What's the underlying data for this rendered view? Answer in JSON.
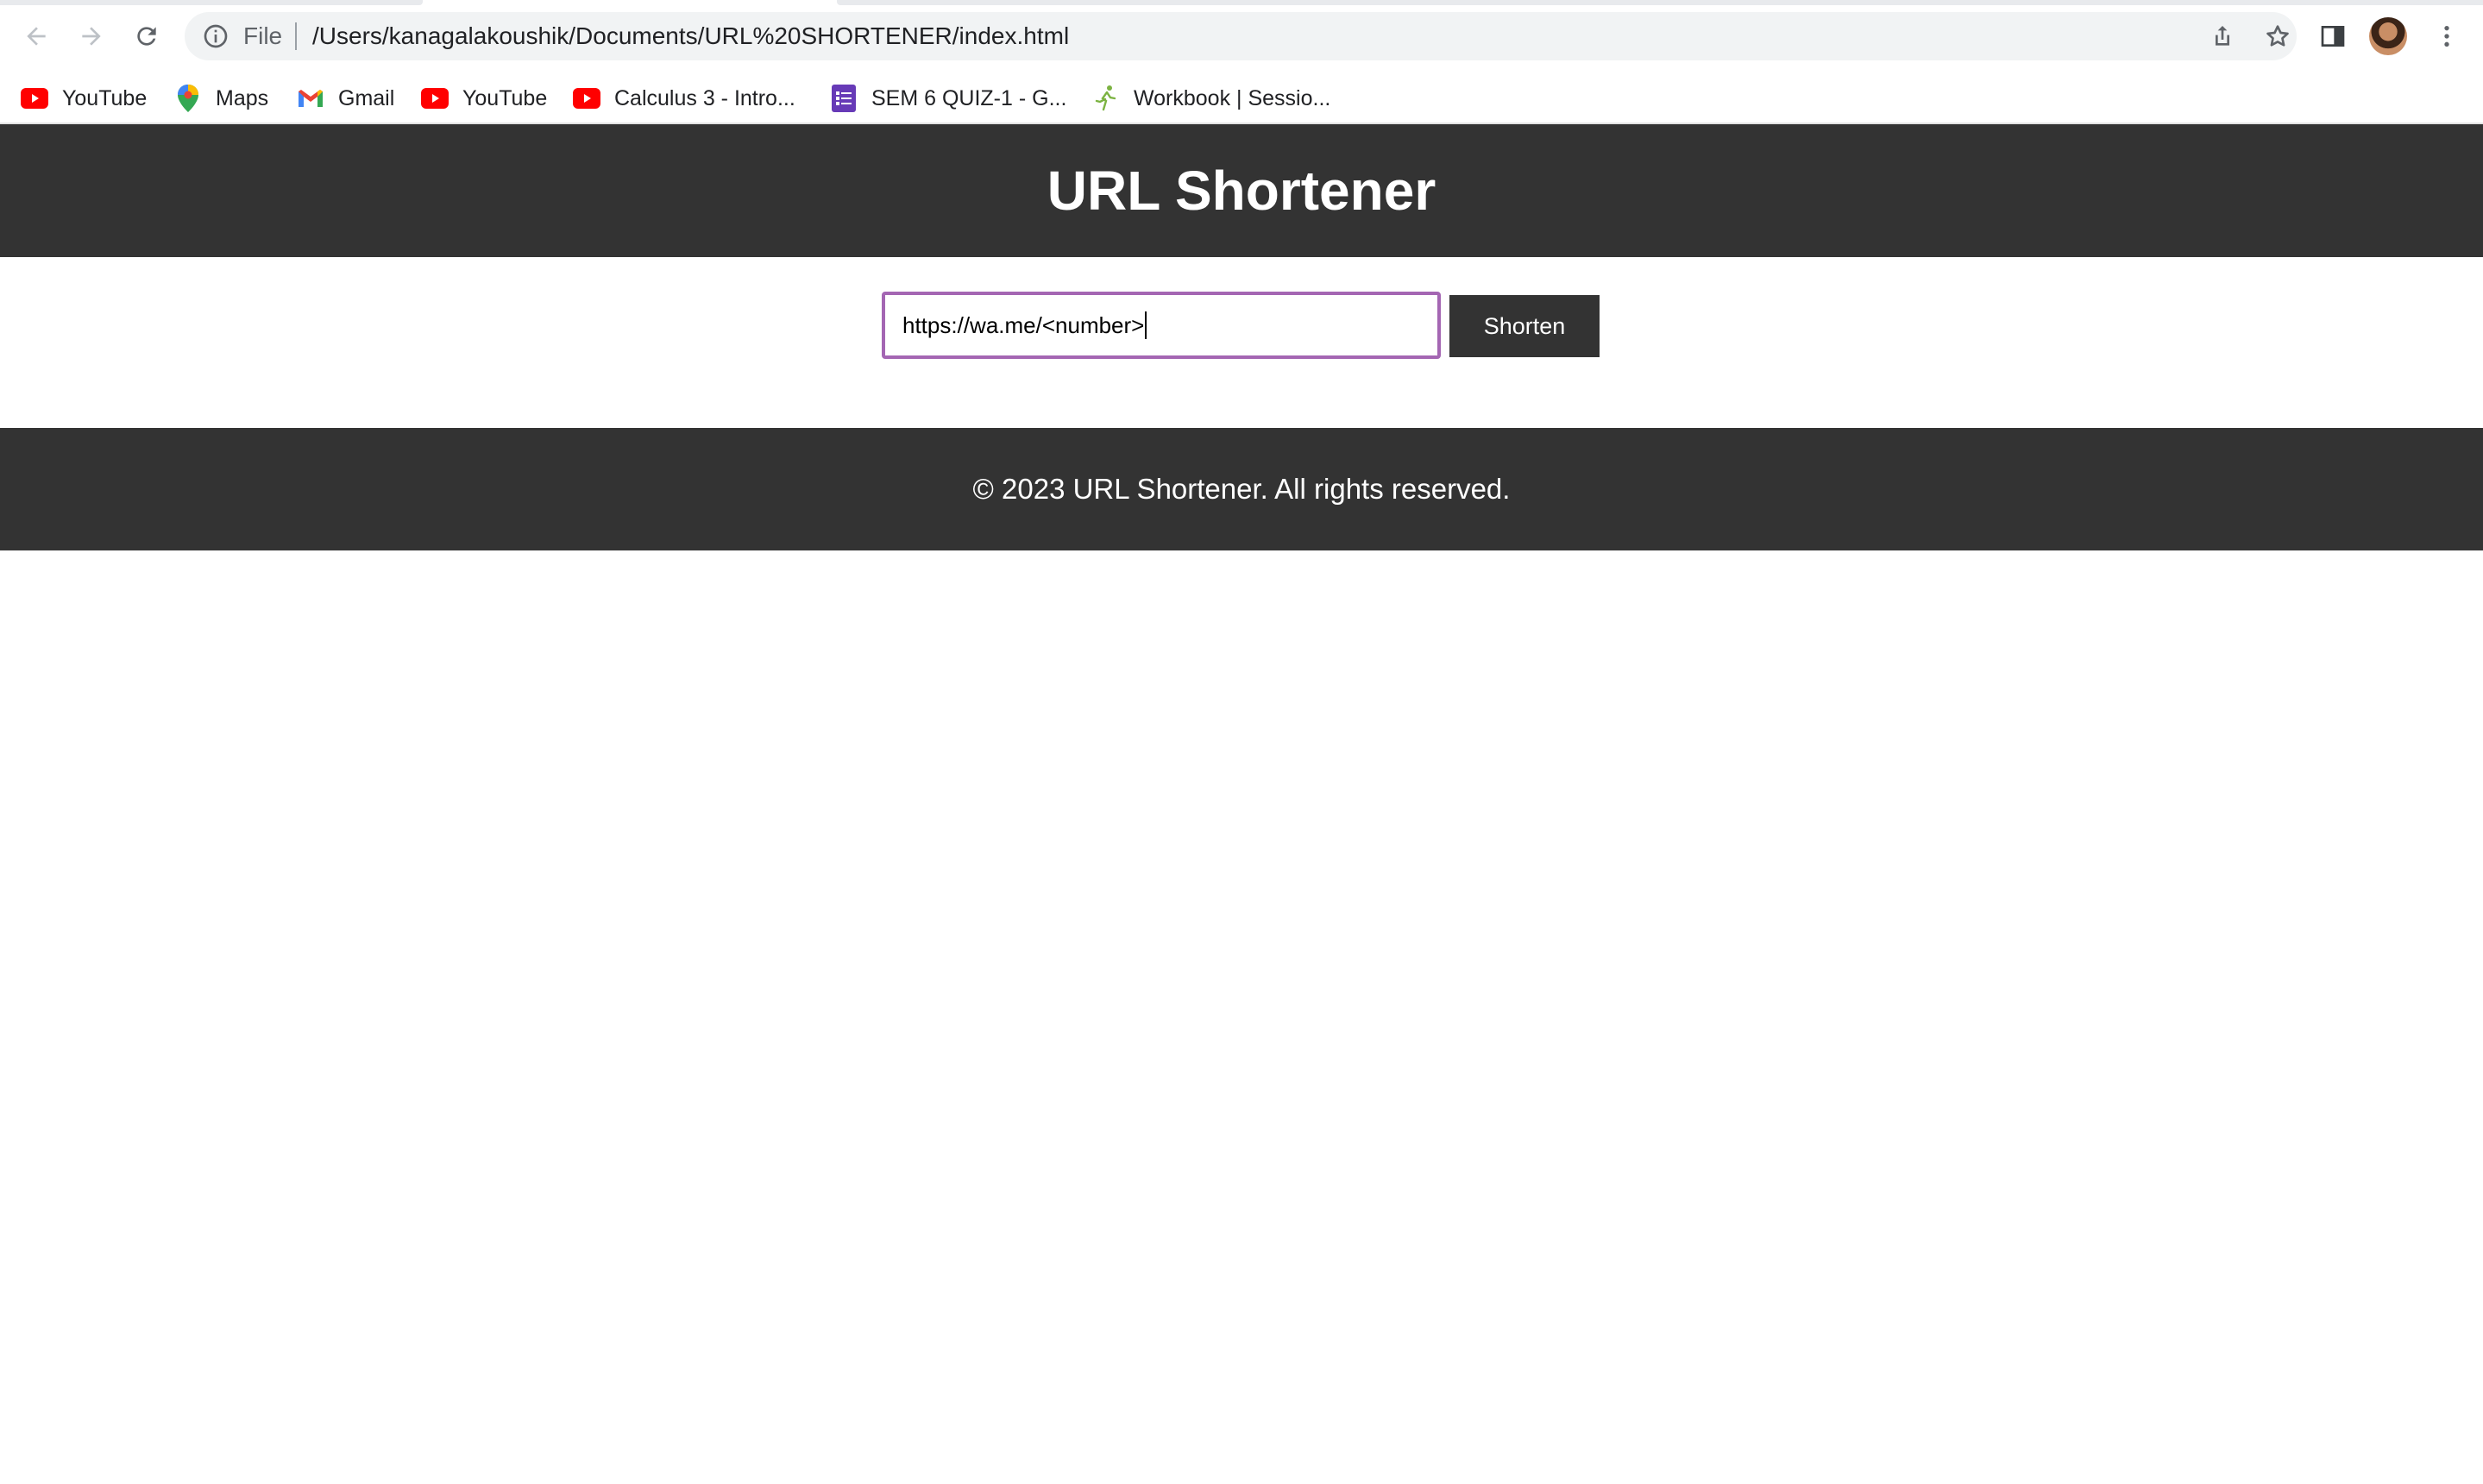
{
  "browser": {
    "omnibox": {
      "scheme_label": "File",
      "url": "/Users/kanagalakoushik/Documents/URL%20SHORTENER/index.html"
    },
    "bookmarks": [
      {
        "label": "YouTube",
        "icon": "youtube-icon"
      },
      {
        "label": "Maps",
        "icon": "maps-icon"
      },
      {
        "label": "Gmail",
        "icon": "gmail-icon"
      },
      {
        "label": "YouTube",
        "icon": "youtube-icon"
      },
      {
        "label": "Calculus 3 - Intro...",
        "icon": "youtube-icon"
      },
      {
        "label": "SEM 6 QUIZ-1 - G...",
        "icon": "forms-icon"
      },
      {
        "label": "Workbook | Sessio...",
        "icon": "runner-icon"
      }
    ]
  },
  "page": {
    "title": "URL Shortener",
    "input_value": "https://wa.me/<number>",
    "shorten_label": "Shorten",
    "footer": "© 2023 URL Shortener. All rights reserved."
  },
  "colors": {
    "header_bg": "#333333",
    "footer_bg": "#333333",
    "input_focus_border": "#a466b3",
    "button_bg": "#333333"
  }
}
